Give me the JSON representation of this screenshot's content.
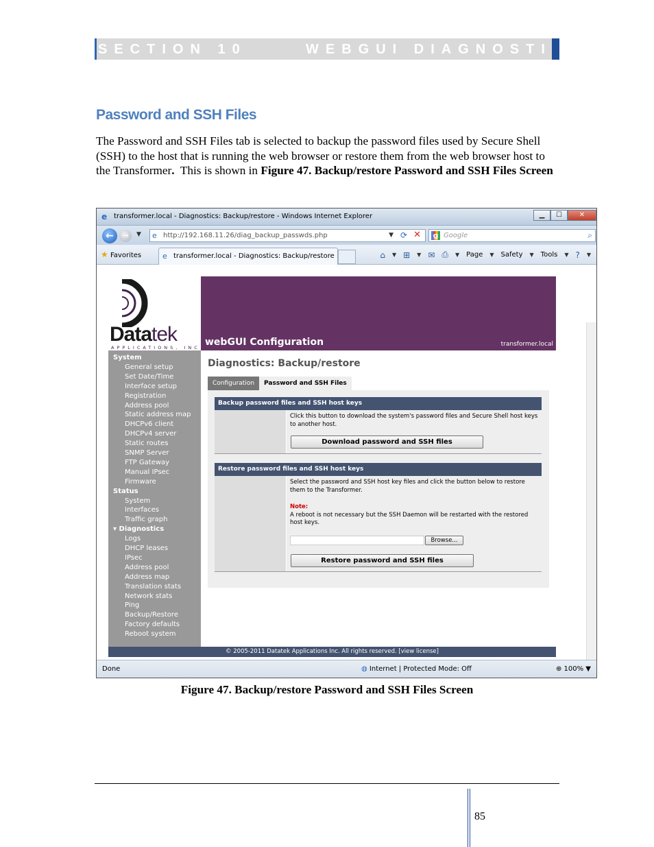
{
  "section_header": {
    "left": "SECTION 10",
    "right": "WEBGUI DIAGNOSTICS"
  },
  "heading": "Password and SSH Files",
  "body": {
    "part1": "The Password and SSH Files tab is selected to backup the password files used by Secure Shell (SSH) to the host that is running the web browser or restore them from the web browser host to the Transformer",
    "part2": ".",
    "part3": "  This is shown in ",
    "part4": "Figure 47. Backup/restore Password and SSH Files Screen"
  },
  "caption": "Figure 47. Backup/restore Password and SSH Files Screen",
  "page_number": "85",
  "browser": {
    "title": "transformer.local - Diagnostics: Backup/restore - Windows Internet Explorer",
    "url": "http://192.168.11.26/diag_backup_passwds.php",
    "search_placeholder": "Google",
    "favorites": "Favorites",
    "tab_label": "transformer.local - Diagnostics: Backup/restore",
    "cmd_page": "Page",
    "cmd_safety": "Safety",
    "cmd_tools": "Tools",
    "status_done": "Done",
    "status_zone": "Internet | Protected Mode: Off",
    "zoom": "100%"
  },
  "webgui": {
    "logo_main": "Data",
    "logo_tek": "tek",
    "logo_sub": "APPLICATIONS, INC",
    "banner_title": "webGUI Configuration",
    "banner_host": "transformer.local",
    "nav": {
      "system": "System",
      "system_items": [
        "General setup",
        "Set Date/Time",
        "Interface setup",
        "Registration",
        "Address pool",
        "Static address map",
        "DHCPv6 client",
        "DHCPv4 server",
        "Static routes",
        "SNMP Server",
        "FTP Gateway",
        "Manual IPsec",
        "Firmware"
      ],
      "status": "Status",
      "status_items": [
        "System",
        "Interfaces",
        "Traffic graph"
      ],
      "diagnostics": "Diagnostics",
      "diagnostics_items": [
        "Logs",
        "DHCP leases",
        "IPsec",
        "Address pool",
        "Address map",
        "Translation stats",
        "Network stats",
        "Ping",
        "Backup/Restore",
        "Factory defaults",
        "Reboot system"
      ]
    },
    "page_title": "Diagnostics: Backup/restore",
    "tabs": [
      "Configuration",
      "Password and SSH Files"
    ],
    "backup": {
      "heading": "Backup password files and SSH host keys",
      "desc": "Click this button to download the system's password files and Secure Shell host keys to another host.",
      "button": "Download password and SSH files"
    },
    "restore": {
      "heading": "Restore password files and SSH host keys",
      "desc": "Select the password and SSH host key files and click the button below to restore them to the Transformer.",
      "note_label": "Note:",
      "note": "A reboot is not necessary but the SSH Daemon will be restarted with the restored host keys.",
      "browse": "Browse...",
      "button": "Restore password and SSH files"
    },
    "footer": "© 2005-2011 Datatek Applications Inc. All rights reserved.  [view license]"
  }
}
